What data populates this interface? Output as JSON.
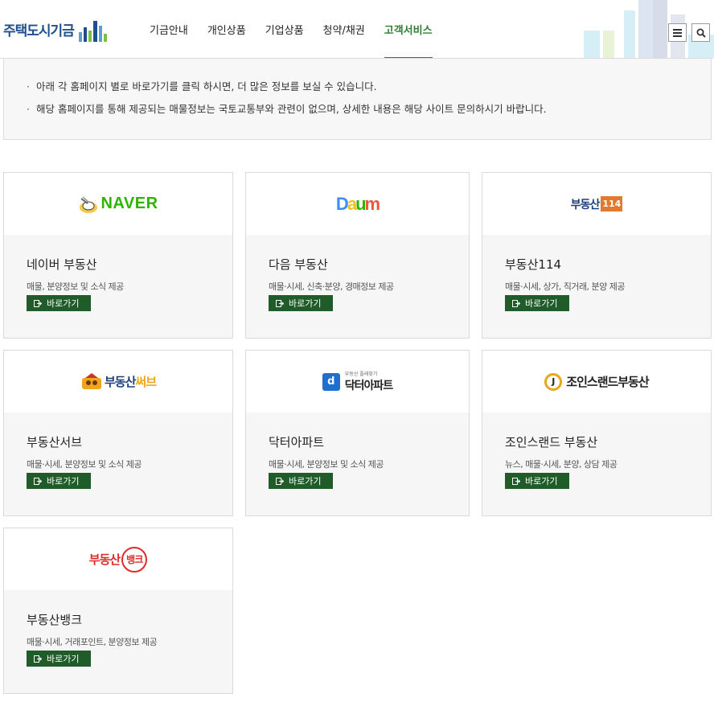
{
  "header": {
    "logo_text": "주택도시기금",
    "nav": [
      {
        "label": "기금안내"
      },
      {
        "label": "개인상품"
      },
      {
        "label": "기업상품"
      },
      {
        "label": "청약/채권"
      },
      {
        "label": "고객서비스"
      }
    ],
    "active_nav": "고객서비스"
  },
  "notice": {
    "lines": [
      "아래 각 홈페이지 별로 바로가기를 클릭 하시면, 더 많은 정보를 보실 수 있습니다.",
      "해당 홈페이지를 통해 제공되는 매물정보는 국토교통부와 관련이 없으며, 상세한 내용은 해당 사이트 문의하시기 바랍니다."
    ]
  },
  "go_label": "바로가기",
  "cards": [
    {
      "logo_text": "NAVER",
      "title": "네이버 부동산",
      "desc": "매물, 분양정보 및 소식 제공"
    },
    {
      "logo_text": "Daum",
      "title": "다음 부동산",
      "desc": "매물·시세, 신축·분양, 경매정보 제공"
    },
    {
      "logo_text": "부동산114",
      "title": "부동산114",
      "desc": "매물·시세, 상가, 직거래, 분양 제공"
    },
    {
      "logo_text": "부동산써브",
      "title": "부동산서브",
      "desc": "매물·시세, 분양정보 및 소식 제공"
    },
    {
      "logo_small": "부동산 플래찾기",
      "logo_text": "닥터아파트",
      "title": "닥터아파트",
      "desc": "매물·시세, 분양정보 및 소식 제공"
    },
    {
      "logo_text": "조인스랜드부동산",
      "title": "조인스랜드 부동산",
      "desc": "뉴스, 매물·시세, 분양, 상담 제공"
    },
    {
      "logo_text": "부동산뱅크",
      "title": "부동산뱅크",
      "desc": "매물·시세, 거래포인트, 분양정보 제공"
    }
  ],
  "colors": {
    "brand_blue": "#1f4e8c",
    "accent_green": "#2f7d32",
    "button_green": "#1f5c2a",
    "naver_green": "#2db400",
    "bank_red": "#e02b2b"
  },
  "icons": [
    "menu-icon",
    "search-icon",
    "link-out-icon"
  ]
}
